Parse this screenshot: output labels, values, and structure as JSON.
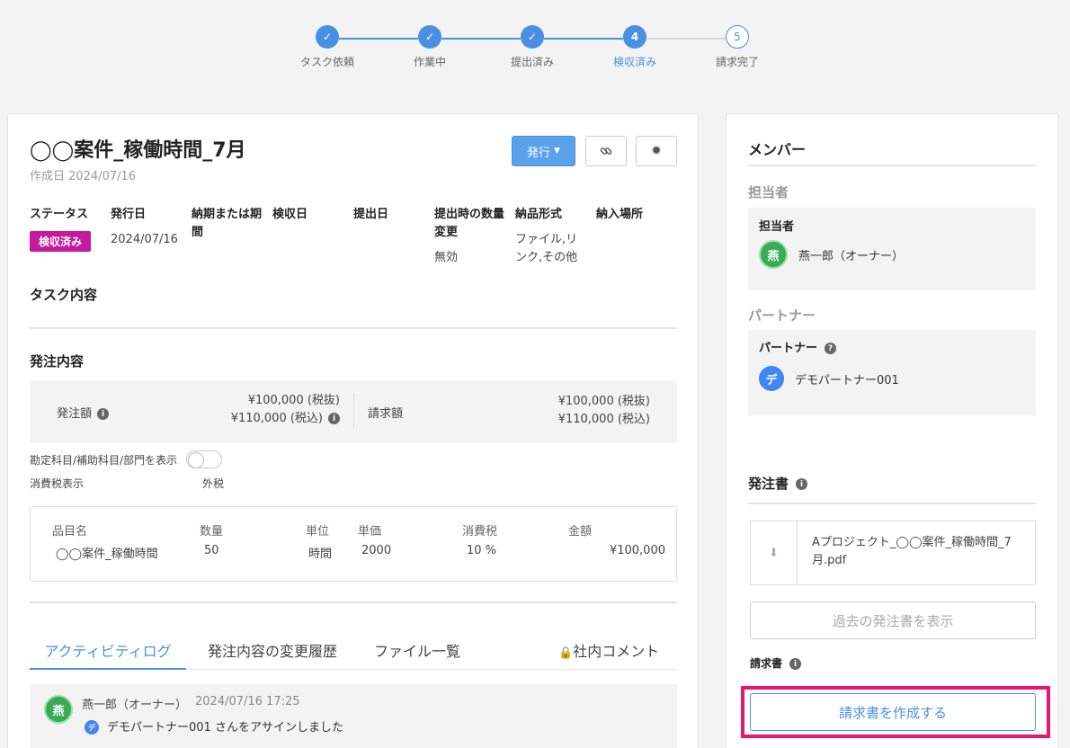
{
  "stepper": {
    "steps": [
      {
        "label": "タスク依頼",
        "state": "done",
        "mark": "✓"
      },
      {
        "label": "作業中",
        "state": "done",
        "mark": "✓"
      },
      {
        "label": "提出済み",
        "state": "done",
        "mark": "✓"
      },
      {
        "label": "検収済み",
        "state": "current",
        "mark": "4"
      },
      {
        "label": "請求完了",
        "state": "todo",
        "mark": "5"
      }
    ]
  },
  "task": {
    "title": "◯◯案件_稼働時間_7月",
    "created": "作成日 2024/07/16",
    "issue_button": "発行",
    "link_icon": "link-icon",
    "settings_icon": "gear-icon"
  },
  "fields": {
    "status_h": "ステータス",
    "status_v": "検収済み",
    "issued_h": "発行日",
    "issued_v": "2024/07/16",
    "deadline_h": "納期または期間",
    "inspected_h": "検収日",
    "submitted_h": "提出日",
    "qty_change_h": "提出時の数量変更",
    "qty_change_v": "無効",
    "format_h": "納品形式",
    "format_v": "ファイル,リンク,その他",
    "place_h": "納入場所"
  },
  "sections": {
    "task_content": "タスク内容",
    "order_content": "発注内容"
  },
  "amounts": {
    "order_label": "発注額",
    "order_excl": "¥100,000 (税抜)",
    "order_incl": "¥110,000 (税込)",
    "invoice_label": "請求額",
    "invoice_excl": "¥100,000 (税抜)",
    "invoice_incl": "¥110,000 (税込)"
  },
  "accounts_toggle_label": "勘定科目/補助科目/部門を表示",
  "tax": {
    "label": "消費税表示",
    "value": "外税"
  },
  "items": {
    "headers": [
      "品目名",
      "数量",
      "単位",
      "単価",
      "消費税",
      "金額"
    ],
    "row": [
      "◯◯案件_稼働時間",
      "50",
      "時間",
      "2000",
      "10 %",
      "¥100,000"
    ]
  },
  "tabs": [
    "アクティビティログ",
    "発注内容の変更履歴",
    "ファイル一覧",
    "社内コメント"
  ],
  "activity": {
    "user": "燕一郎（オーナー）",
    "time": "2024/07/16 17:25",
    "avatar_char": "燕",
    "message_avatar": "デ",
    "message": "デモパートナー001 さんをアサインしました"
  },
  "side": {
    "members_title": "メンバー",
    "assignee_section": "担当者",
    "assignee_header": "担当者",
    "assignee_name": "燕一郎（オーナー）",
    "assignee_avatar": "燕",
    "partner_section": "パートナー",
    "partner_header": "パートナー",
    "partner_name": "デモパートナー001",
    "partner_avatar": "デ",
    "po_title": "発注書",
    "po_file": "Aプロジェクト_◯◯案件_稼働時間_7月.pdf",
    "past_po_button": "過去の発注書を表示",
    "invoice_label": "請求書",
    "create_invoice_button": "請求書を作成する"
  },
  "colors": {
    "accent": "#4a90e2",
    "status_badge": "#c41a9b",
    "highlight": "#e8166d"
  }
}
